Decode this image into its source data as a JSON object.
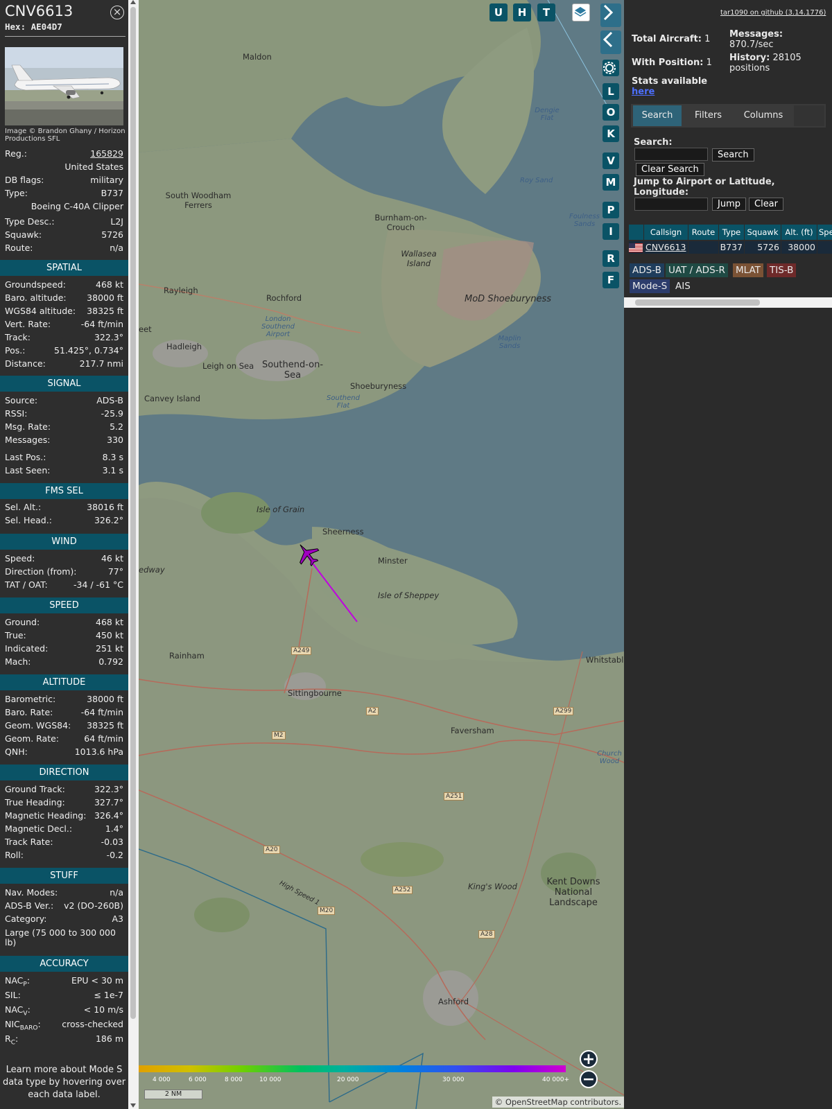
{
  "aircraft": {
    "callsign": "CNV6613",
    "hex_label": "Hex: AE04D7",
    "photo_credit": "Image © Brandon Ghany / Horizon Productions SFL"
  },
  "info_rows": [
    {
      "k": "Reg.:",
      "v": "165829",
      "link": true
    },
    {
      "k": "",
      "v": "United States"
    },
    {
      "k": "DB flags:",
      "v": "military"
    },
    {
      "k": "Type:",
      "v": "B737"
    },
    {
      "k": "",
      "v": "Boeing C-40A Clipper"
    },
    {
      "k": "Type Desc.:",
      "v": "L2J"
    },
    {
      "k": "Squawk:",
      "v": "5726"
    },
    {
      "k": "Route:",
      "v": "n/a"
    }
  ],
  "sections": {
    "spatial": "SPATIAL",
    "signal": "SIGNAL",
    "fms": "FMS SEL",
    "wind": "WIND",
    "speed": "SPEED",
    "altitude": "ALTITUDE",
    "direction": "DIRECTION",
    "stuff": "STUFF",
    "accuracy": "ACCURACY"
  },
  "spatial": [
    {
      "k": "Groundspeed:",
      "v": "468 kt"
    },
    {
      "k": "Baro. altitude:",
      "v": "38000 ft"
    },
    {
      "k": "WGS84 altitude:",
      "v": "38325 ft"
    },
    {
      "k": "Vert. Rate:",
      "v": "-64 ft/min"
    },
    {
      "k": "Track:",
      "v": "322.3°"
    },
    {
      "k": "Pos.:",
      "v": "51.425°, 0.734°"
    },
    {
      "k": "Distance:",
      "v": "217.7 nmi"
    }
  ],
  "signal": [
    {
      "k": "Source:",
      "v": "ADS-B"
    },
    {
      "k": "RSSI:",
      "v": "-25.9"
    },
    {
      "k": "Msg. Rate:",
      "v": "5.2"
    },
    {
      "k": "Messages:",
      "v": "330"
    },
    {
      "k": "Last Pos.:",
      "v": "8.3 s"
    },
    {
      "k": "Last Seen:",
      "v": "3.1 s"
    }
  ],
  "fms": [
    {
      "k": "Sel. Alt.:",
      "v": "38016 ft"
    },
    {
      "k": "Sel. Head.:",
      "v": "326.2°"
    }
  ],
  "wind": [
    {
      "k": "Speed:",
      "v": "46 kt"
    },
    {
      "k": "Direction (from):",
      "v": "77°"
    },
    {
      "k": "TAT / OAT:",
      "v": "-34 / -61 °C"
    }
  ],
  "speed": [
    {
      "k": "Ground:",
      "v": "468 kt"
    },
    {
      "k": "True:",
      "v": "450 kt"
    },
    {
      "k": "Indicated:",
      "v": "251 kt"
    },
    {
      "k": "Mach:",
      "v": "0.792"
    }
  ],
  "altitude": [
    {
      "k": "Barometric:",
      "v": "38000 ft"
    },
    {
      "k": "Baro. Rate:",
      "v": "-64 ft/min"
    },
    {
      "k": "Geom. WGS84:",
      "v": "38325 ft"
    },
    {
      "k": "Geom. Rate:",
      "v": "64 ft/min"
    },
    {
      "k": "QNH:",
      "v": "1013.6 hPa"
    }
  ],
  "direction": [
    {
      "k": "Ground Track:",
      "v": "322.3°"
    },
    {
      "k": "True Heading:",
      "v": "327.7°"
    },
    {
      "k": "Magnetic Heading:",
      "v": "326.4°"
    },
    {
      "k": "Magnetic Decl.:",
      "v": "1.4°"
    },
    {
      "k": "Track Rate:",
      "v": "-0.03"
    },
    {
      "k": "Roll:",
      "v": "-0.2"
    }
  ],
  "stuff": [
    {
      "k": "Nav. Modes:",
      "v": "n/a"
    },
    {
      "k": "ADS-B Ver.:",
      "v": "v2 (DO-260B)"
    },
    {
      "k": "Category:",
      "v": "A3"
    }
  ],
  "stuff_category_desc": "Large (75 000 to 300 000 lb)",
  "accuracy": [
    {
      "k": "NAC",
      "sub": "P",
      "v": "EPU < 30 m"
    },
    {
      "k": "SIL:",
      "sub": "",
      "v": "≤ 1e-7"
    },
    {
      "k": "NAC",
      "sub": "V",
      "v": "< 10 m/s"
    },
    {
      "k": "NIC",
      "sub": "BARO",
      "v": "cross-checked"
    },
    {
      "k": "R",
      "sub": "C",
      "v": "186 m"
    }
  ],
  "learn_more": "Learn more about Mode S data type by hovering over each data label.",
  "map": {
    "buttons": [
      "U",
      "H",
      "T"
    ],
    "side_buttons": [
      "L",
      "O",
      "K",
      "V",
      "M",
      "P",
      "I",
      "R",
      "F"
    ],
    "places": [
      {
        "n": "Maldon"
      },
      {
        "n": "South Woodham Ferrers"
      },
      {
        "n": "Burnham-on-Crouch"
      },
      {
        "n": "Wallasea Island"
      },
      {
        "n": "Rayleigh"
      },
      {
        "n": "Rochford"
      },
      {
        "n": "MoD Shoeburyness"
      },
      {
        "n": "London Southend Airport"
      },
      {
        "n": "Hadleigh"
      },
      {
        "n": "Leigh on Sea"
      },
      {
        "n": "Southend-on-Sea"
      },
      {
        "n": "Shoeburyness"
      },
      {
        "n": "Canvey Island"
      },
      {
        "n": "Southend Flat"
      },
      {
        "n": "Maplin Sands"
      },
      {
        "n": "Foulness Sands"
      },
      {
        "n": "Dengie Flat"
      },
      {
        "n": "Roy Sand"
      },
      {
        "n": "Isle of Grain"
      },
      {
        "n": "Sheerness"
      },
      {
        "n": "Minster"
      },
      {
        "n": "Isle of Sheppey"
      },
      {
        "n": "Rainham"
      },
      {
        "n": "Sittingbourne"
      },
      {
        "n": "Whitstable"
      },
      {
        "n": "Faversham"
      },
      {
        "n": "Church Wood"
      },
      {
        "n": "King's Wood"
      },
      {
        "n": "Kent Downs National Landscape"
      },
      {
        "n": "Ashford"
      },
      {
        "n": "High Speed 1"
      },
      {
        "n": "eet"
      },
      {
        "n": "edway"
      }
    ],
    "roads": [
      "A249",
      "A2",
      "A299",
      "M2",
      "A251",
      "A20",
      "A252",
      "M20",
      "A28"
    ],
    "legend_labels": [
      "4 000",
      "6 000",
      "8 000",
      "10 000",
      "20 000",
      "30 000",
      "40 000+"
    ],
    "scale": "2 NM",
    "attribution_prefix": "© ",
    "attribution_link": "OpenStreetMap",
    "attribution_suffix": " contributors."
  },
  "right": {
    "github": "tar1090 on github (3.14.1776)",
    "total_aircraft_label": "Total Aircraft:",
    "total_aircraft": "1",
    "with_position_label": "With Position:",
    "with_position": "1",
    "messages_label": "Messages:",
    "messages": "870.7/sec",
    "history_label": "History:",
    "history": "28105 positions",
    "stats_available": "Stats available",
    "here": "here",
    "tabs": [
      "Search",
      "Filters",
      "Columns"
    ],
    "search_label": "Search:",
    "search_btn": "Search",
    "clear_search_btn": "Clear Search",
    "jump_label": "Jump to Airport or Latitude, Longitude:",
    "jump_btn": "Jump",
    "clear_btn": "Clear",
    "columns": [
      "Callsign",
      "Route",
      "Type",
      "Squawk",
      "Alt. (ft)",
      "Spe"
    ],
    "row": {
      "callsign": "CNV6613",
      "route": "",
      "type": "B737",
      "squawk": "5726",
      "alt": "38000"
    },
    "chips": [
      {
        "t": "ADS-B",
        "bg": "#1f3d5c"
      },
      {
        "t": "UAT / ADS-R",
        "bg": "#1f4a44"
      },
      {
        "t": "MLAT",
        "bg": "#7a5235"
      },
      {
        "t": "TIS-B",
        "bg": "#6e2a2a"
      },
      {
        "t": "Mode-S",
        "bg": "#2c3c6c"
      },
      {
        "t": "AIS",
        "bg": ""
      }
    ]
  }
}
